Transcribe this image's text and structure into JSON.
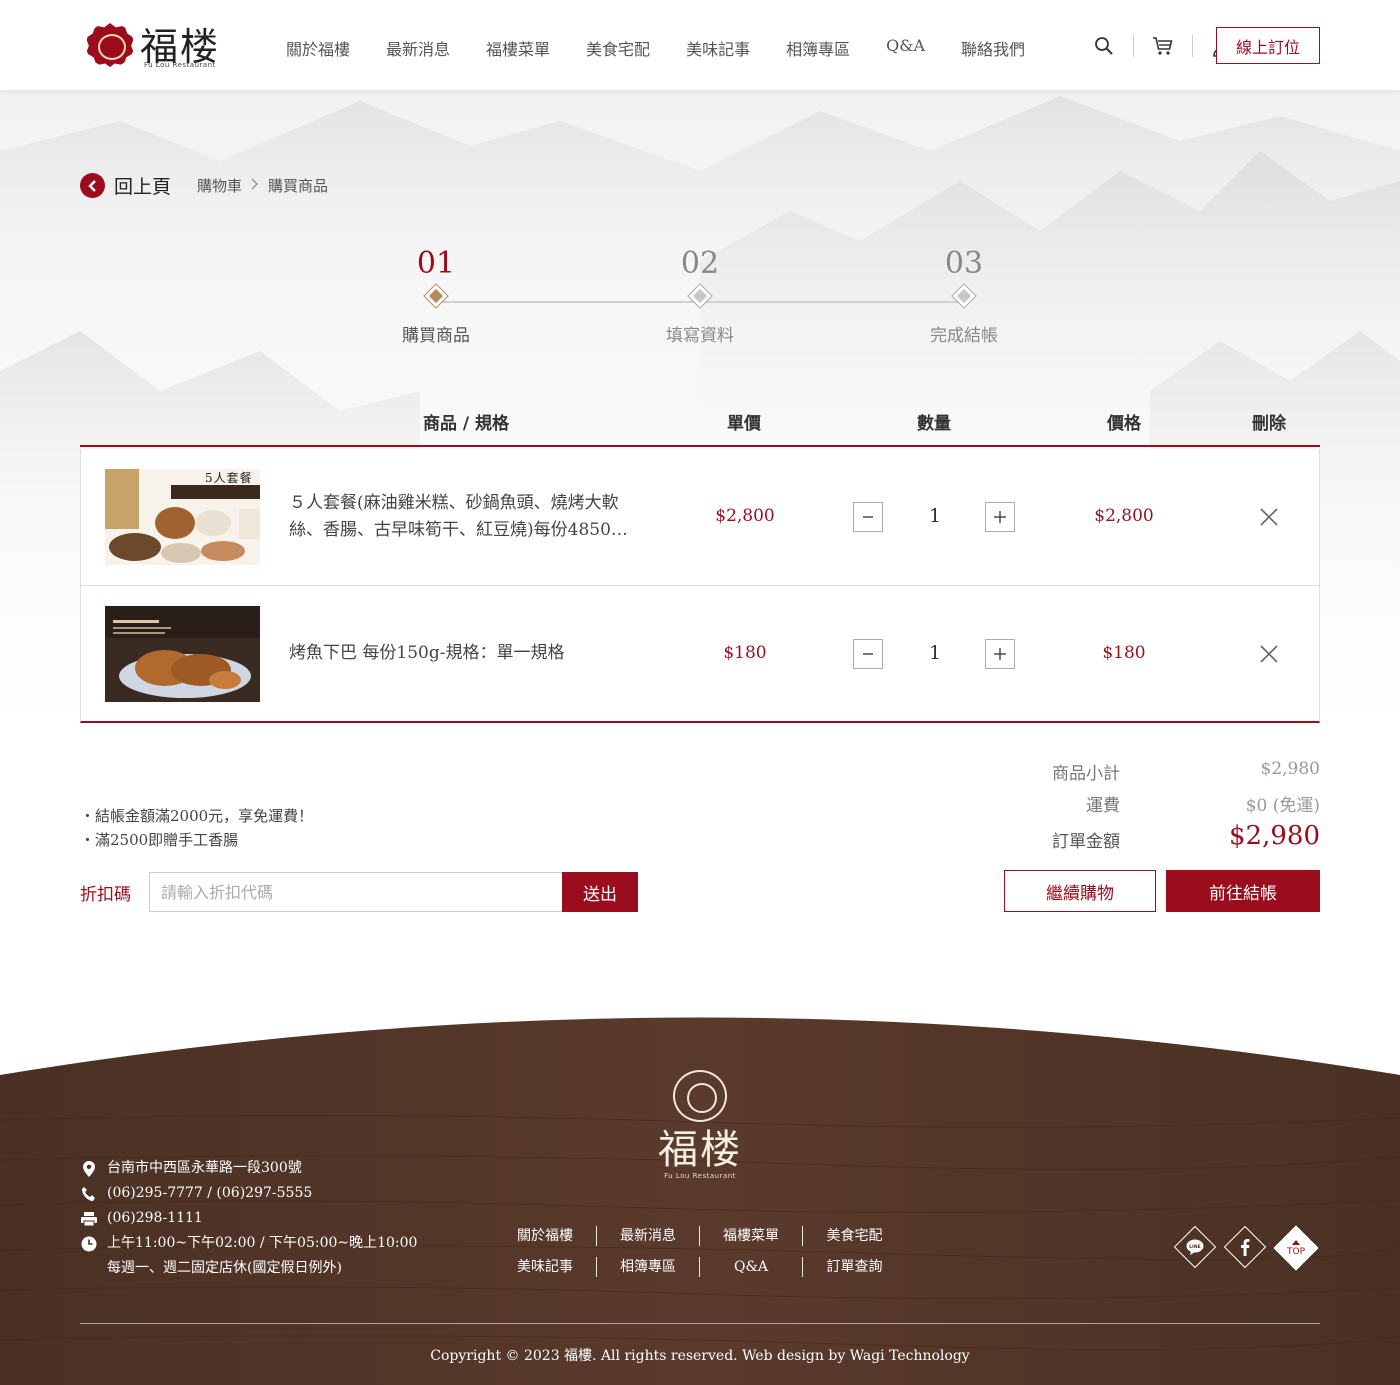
{
  "brand": {
    "logo_text": "福楼",
    "logo_sub": "Fu Lou Restaurant",
    "accent": "#9b0d1c",
    "gold": "#b48a5a"
  },
  "nav": {
    "items": [
      "關於福樓",
      "最新消息",
      "福樓菜單",
      "美食宅配",
      "美味記事",
      "相簿專區",
      "Q&A",
      "聯絡我們"
    ],
    "book_label": "線上訂位"
  },
  "breadcrumb": {
    "back": "回上頁",
    "items": [
      "購物車",
      "購買商品"
    ]
  },
  "steps": [
    {
      "num": "01",
      "label": "購買商品",
      "active": true
    },
    {
      "num": "02",
      "label": "填寫資料",
      "active": false
    },
    {
      "num": "03",
      "label": "完成結帳",
      "active": false
    }
  ],
  "cart": {
    "headers": {
      "product": "商品 / 規格",
      "unit_price": "單價",
      "qty": "數量",
      "price": "價格",
      "delete": "刪除"
    },
    "items": [
      {
        "name": "５人套餐(麻油雞米糕、砂鍋魚頭、燒烤大軟絲、香腸、古早味筍干、紅豆燒)每份4850…",
        "thumb_caption": "5人套餐",
        "unit_price": "$2,800",
        "qty": "1",
        "price": "$2,800"
      },
      {
        "name": "烤魚下巴 每份150g-規格：單一規格",
        "unit_price": "$180",
        "qty": "1",
        "price": "$180"
      }
    ]
  },
  "notes": [
    "・結帳金額滿2000元，享免運費！",
    "・滿2500即贈手工香腸"
  ],
  "coupon": {
    "label": "折扣碼",
    "placeholder": "請輸入折扣代碼",
    "value": "",
    "submit": "送出"
  },
  "summary": {
    "subtotal_label": "商品小計",
    "subtotal": "$2,980",
    "shipping_label": "運費",
    "shipping": "$0 (免運)",
    "total_label": "訂單金額",
    "total": "$2,980"
  },
  "actions": {
    "continue": "繼續購物",
    "checkout": "前往結帳"
  },
  "footer": {
    "logo_text": "福楼",
    "logo_sub": "Fu Lou Restaurant",
    "address": "台南市中西區永華路一段300號",
    "phone": "(06)295-7777 / (06)297-5555",
    "fax": "(06)298-1111",
    "hours_1": "上午11:00~下午02:00 / 下午05:00~晚上10:00",
    "hours_2": "每週一、週二固定店休(國定假日例外)",
    "nav": [
      "關於福樓",
      "最新消息",
      "福樓菜單",
      "美食宅配",
      "美味記事",
      "相簿專區",
      "Q&A",
      "訂單查詢"
    ],
    "social": {
      "line": "LINE",
      "top": "TOP"
    },
    "copyright": "Copyright © 2023 福樓. All rights reserved. Web design by Wagi Technology"
  }
}
